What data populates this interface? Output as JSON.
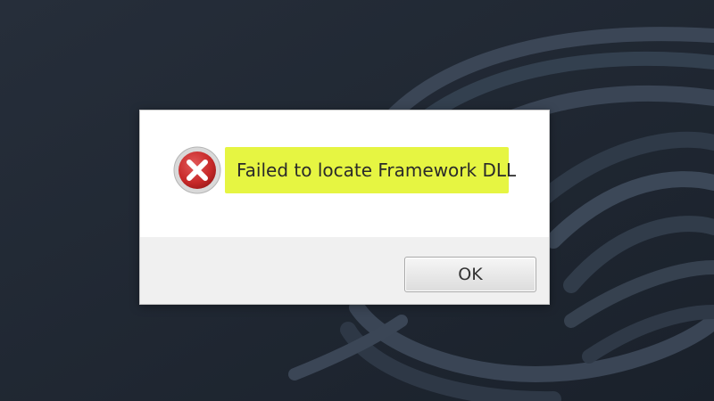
{
  "dialog": {
    "icon": "error-icon",
    "message": "Failed to locate Framework DLL",
    "highlight_color": "#e6f542",
    "ok_label": "OK"
  },
  "colors": {
    "wallpaper": "#1f2733",
    "error_red": "#c62828",
    "dialog_body": "#ffffff",
    "dialog_footer": "#f0f0f0"
  }
}
